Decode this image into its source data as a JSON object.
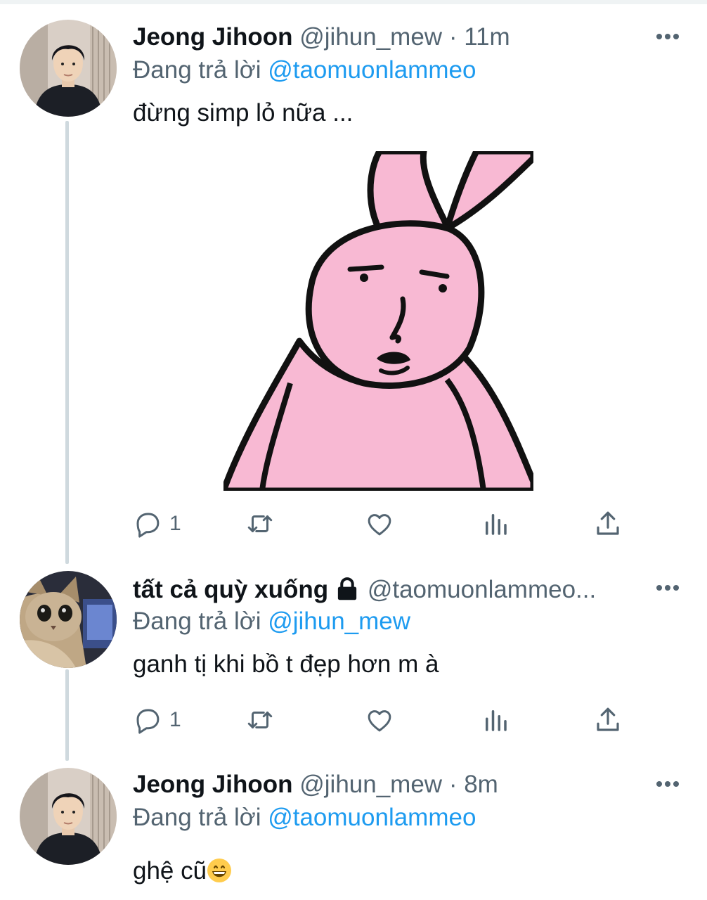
{
  "colors": {
    "accent": "#1d9bf0",
    "secondary": "#536471",
    "thread_line": "#cfd9de",
    "media_pink": "#f8b9d3"
  },
  "tweets": [
    {
      "name": "Jeong Jihoon",
      "handle": "@jihun_mew",
      "separator": "·",
      "time": "11m",
      "reply_prefix": "Đang trả lời",
      "reply_mention": "@taomuonlammeo",
      "text": "đừng simp lỏ nữa ...",
      "reply_count": "1",
      "media": "pink-bunny-sticker"
    },
    {
      "name": "tất cả quỳ xuống",
      "handle": "@taomuonlammeo...",
      "protected_icon": "lock-icon",
      "reply_prefix": "Đang trả lời",
      "reply_mention": "@jihun_mew",
      "text": "ganh tị khi bồ t đẹp hơn m à",
      "reply_count": "1"
    },
    {
      "name": "Jeong Jihoon",
      "handle": "@jihun_mew",
      "separator": "·",
      "time": "8m",
      "reply_prefix": "Đang trả lời",
      "reply_mention": "@taomuonlammeo",
      "text": "ghệ cũ",
      "emoji": "grinning-face-emoji"
    }
  ]
}
